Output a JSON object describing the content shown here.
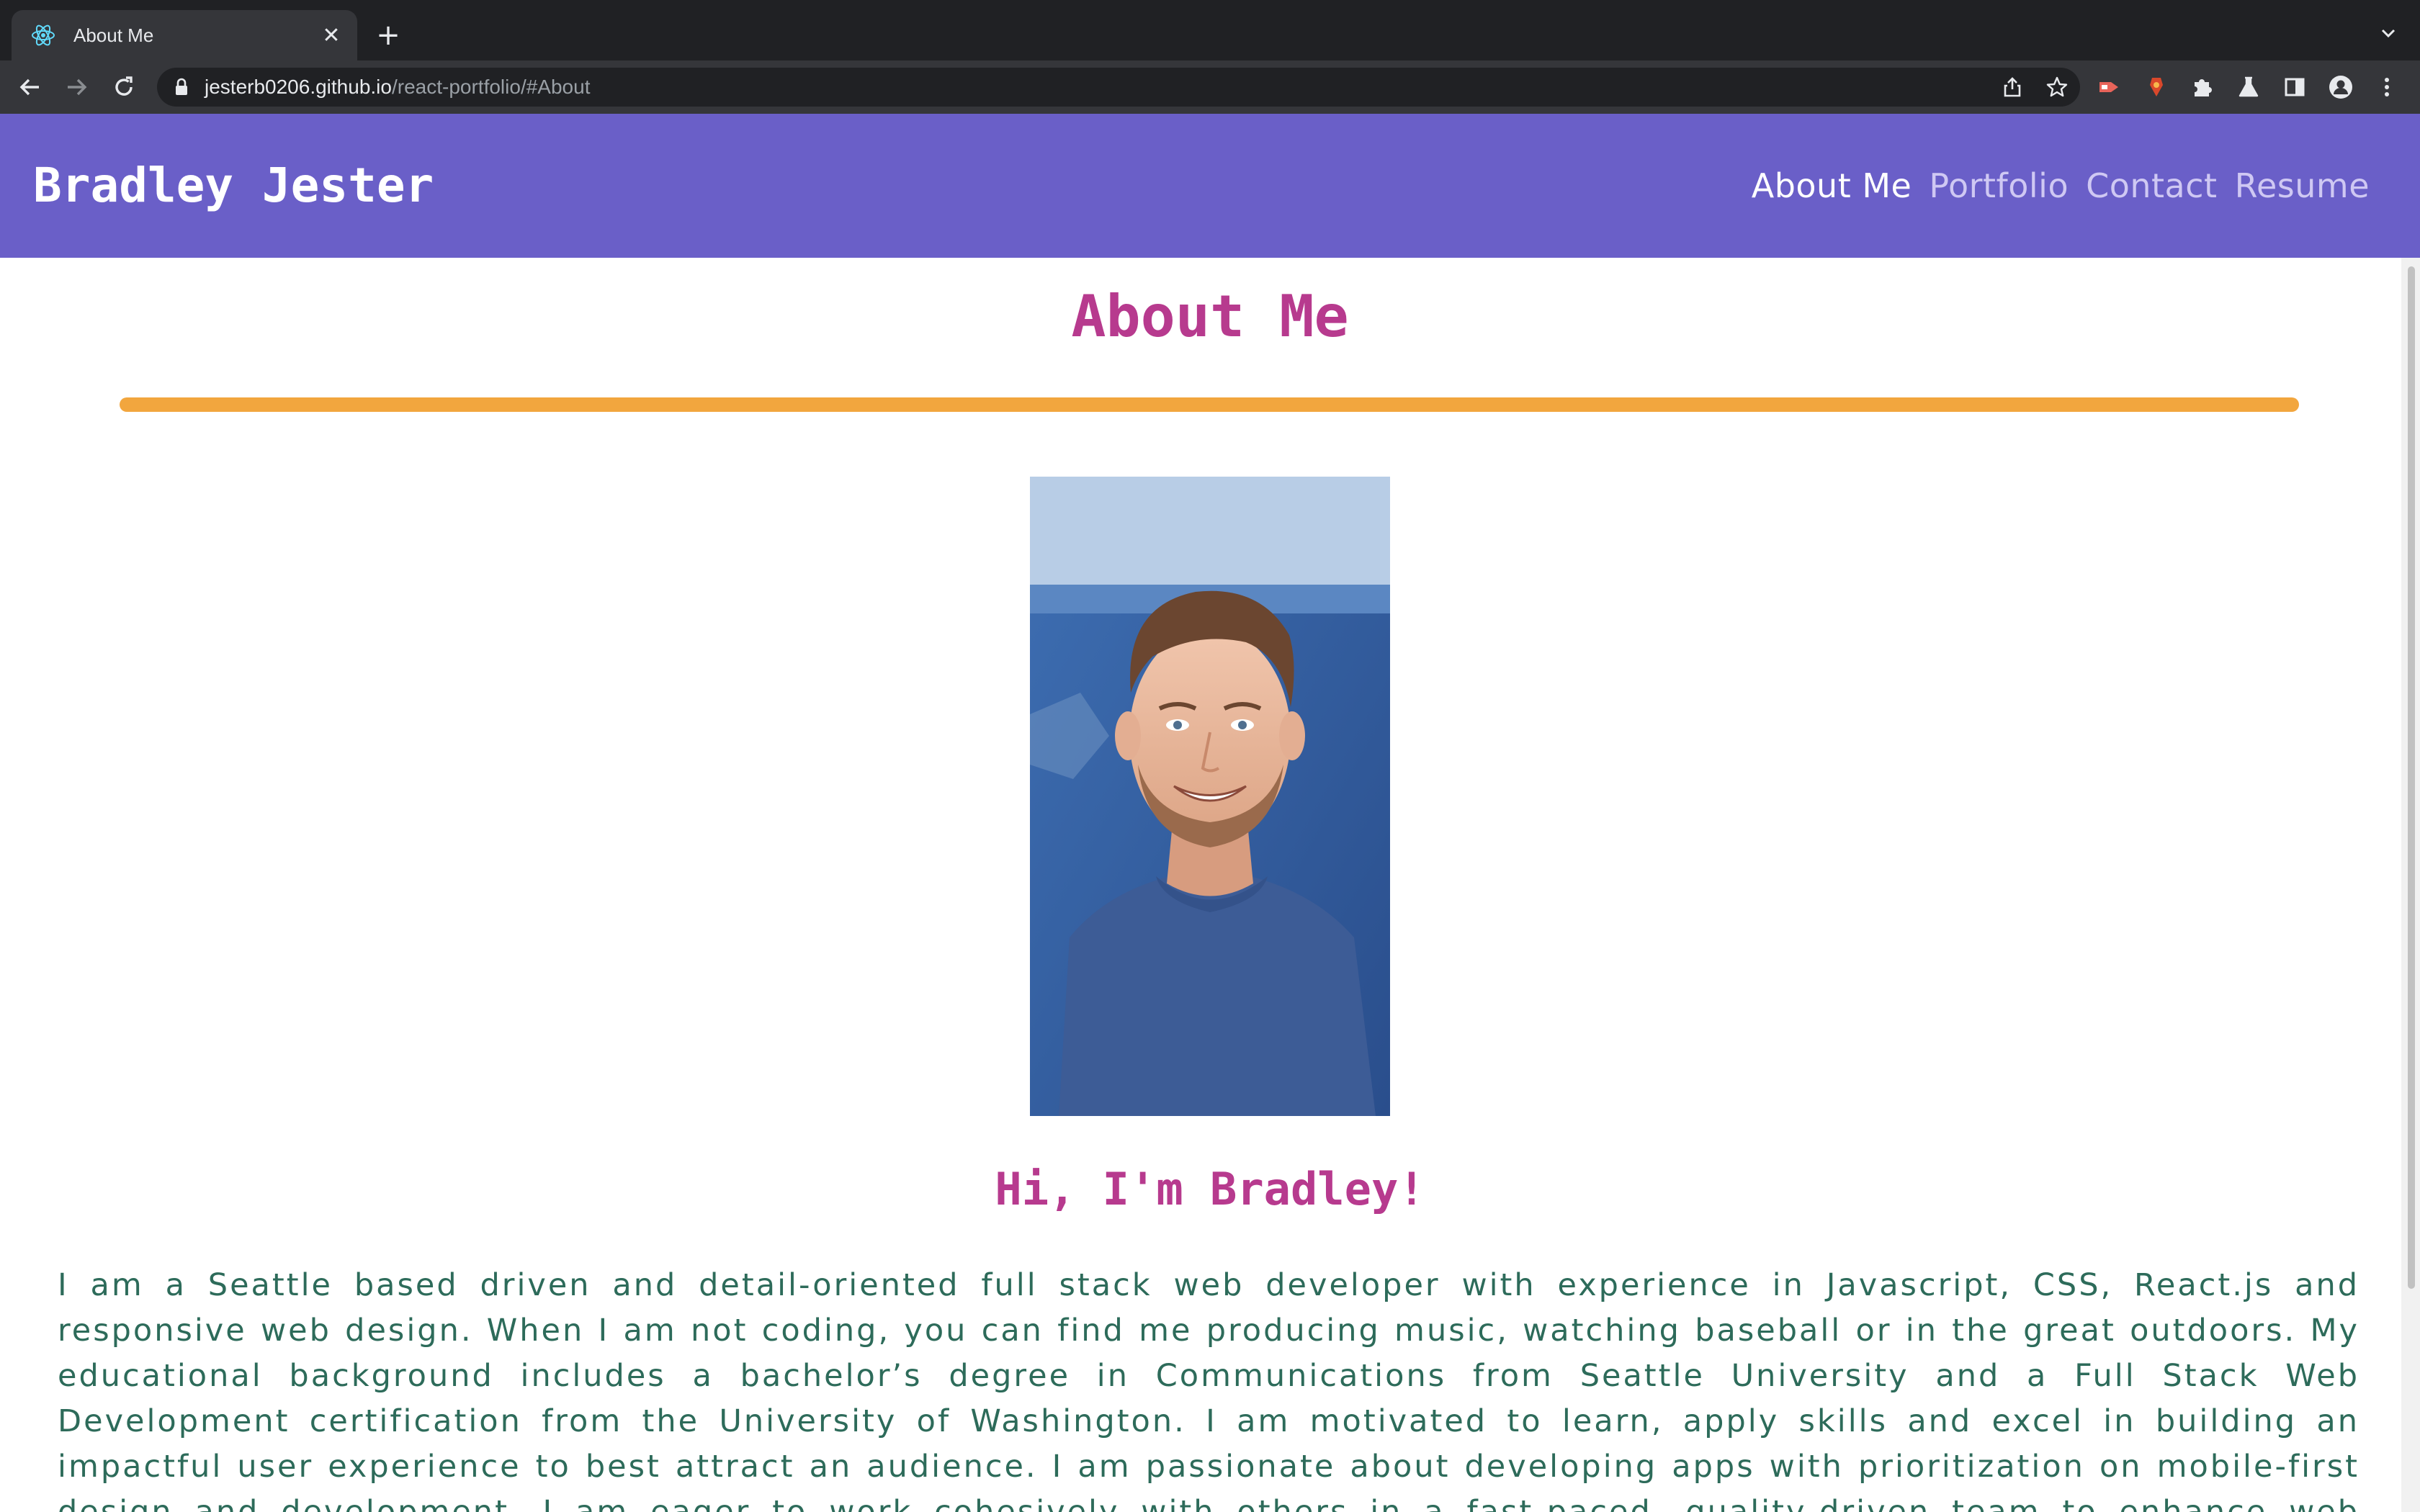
{
  "browser": {
    "tab_title": "About Me",
    "url_host": "jesterb0206.github.io",
    "url_path": "/react-portfolio/#About"
  },
  "site": {
    "brand": "Bradley Jester",
    "nav": [
      {
        "label": "About Me",
        "active": true
      },
      {
        "label": "Portfolio",
        "active": false
      },
      {
        "label": "Contact",
        "active": false
      },
      {
        "label": "Resume",
        "active": false
      }
    ]
  },
  "about": {
    "title": "About Me",
    "greeting": "Hi, I'm Bradley!",
    "bio": "I am a Seattle based driven and detail-oriented full stack web developer with experience in Javascript, CSS, React.js and responsive web design. When I am not coding, you can find me producing music, watching baseball or in the great outdoors. My educational background includes a bachelor’s degree in Communications from Seattle University and a Full Stack Web Development certification from the University of Washington. I am motivated to learn, apply skills and excel in building an impactful user experience to best attract an audience. I am passionate about developing apps with prioritization on mobile-first design and development. I am eager to work cohesively with others in a fast-paced, quality-driven team to enhance web experience."
  },
  "colors": {
    "header_bg": "#6a5fc8",
    "title": "#b73a8e",
    "divider": "#f2a63e",
    "bio_text": "#2d6b5a",
    "chrome_dark": "#202124",
    "chrome_toolbar": "#35363a"
  },
  "icons": {
    "favicon": "react-logo-icon",
    "tab_close": "close-icon",
    "new_tab": "plus-icon",
    "tab_search": "chevron-down-icon",
    "back": "back-arrow-icon",
    "forward": "forward-arrow-icon",
    "reload": "reload-icon",
    "lock": "lock-icon",
    "share": "share-icon",
    "bookmark": "star-icon",
    "extensions": [
      "video-extension-icon",
      "red-extension-icon",
      "puzzle-icon",
      "labs-flask-icon",
      "side-panel-icon",
      "profile-icon",
      "kebab-menu-icon"
    ],
    "portrait": "portrait-photo"
  }
}
